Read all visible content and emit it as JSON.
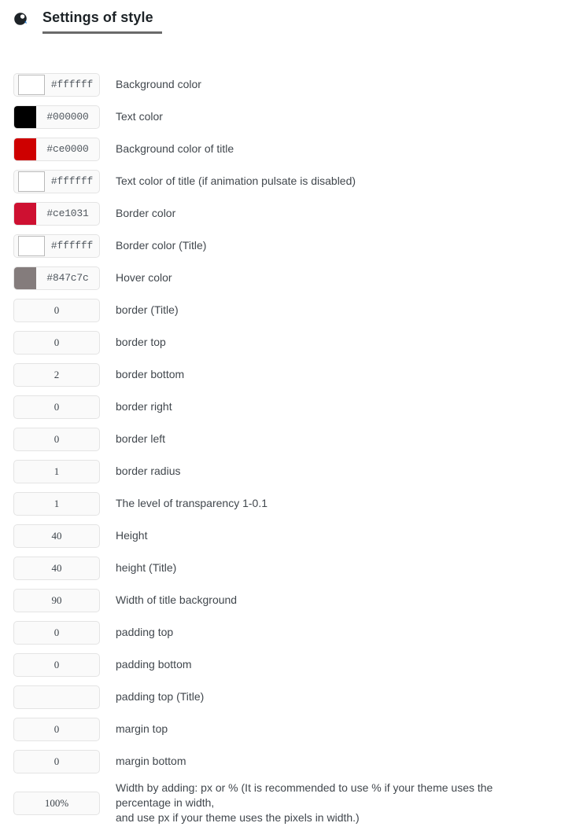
{
  "header": {
    "icon": "eye-swirl-icon",
    "title": "Settings of style"
  },
  "fields": [
    {
      "kind": "color",
      "value": "#ffffff",
      "swatch": "#ffffff",
      "swatch_bordered": true,
      "label": "Background color"
    },
    {
      "kind": "color",
      "value": "#000000",
      "swatch": "#000000",
      "swatch_bordered": false,
      "label": "Text color"
    },
    {
      "kind": "color",
      "value": "#ce0000",
      "swatch": "#ce0000",
      "swatch_bordered": false,
      "label": "Background color of title"
    },
    {
      "kind": "color",
      "value": "#ffffff",
      "swatch": "#ffffff",
      "swatch_bordered": true,
      "label": "Text color of title (if animation pulsate is disabled)"
    },
    {
      "kind": "color",
      "value": "#ce1031",
      "swatch": "#ce1031",
      "swatch_bordered": false,
      "label": "Border color"
    },
    {
      "kind": "color",
      "value": "#ffffff",
      "swatch": "#ffffff",
      "swatch_bordered": true,
      "label": "Border color (Title)"
    },
    {
      "kind": "color",
      "value": "#847c7c",
      "swatch": "#847c7c",
      "swatch_bordered": false,
      "label": "Hover color"
    },
    {
      "kind": "text",
      "value": "0",
      "label": "border (Title)"
    },
    {
      "kind": "text",
      "value": "0",
      "label": "border top"
    },
    {
      "kind": "text",
      "value": "2",
      "label": "border bottom"
    },
    {
      "kind": "text",
      "value": "0",
      "label": "border right"
    },
    {
      "kind": "text",
      "value": "0",
      "label": "border left"
    },
    {
      "kind": "text",
      "value": "1",
      "label": "border radius"
    },
    {
      "kind": "text",
      "value": "1",
      "label": "The level of transparency 1-0.1"
    },
    {
      "kind": "text",
      "value": "40",
      "label": "Height"
    },
    {
      "kind": "text",
      "value": "40",
      "label": "height (Title)"
    },
    {
      "kind": "text",
      "value": "90",
      "label": "Width of title background"
    },
    {
      "kind": "text",
      "value": "0",
      "label": "padding top"
    },
    {
      "kind": "text",
      "value": "0",
      "label": "padding bottom"
    },
    {
      "kind": "text",
      "value": "",
      "label": "padding top (Title)"
    },
    {
      "kind": "text",
      "value": "0",
      "label": "margin top"
    },
    {
      "kind": "text",
      "value": "0",
      "label": "margin bottom"
    },
    {
      "kind": "text",
      "value": "100%",
      "label_lines": [
        "Width by adding: px or % (It is recommended to use % if your theme uses the",
        "percentage in width,",
        "and use px if your theme uses the pixels in width.)"
      ]
    }
  ]
}
